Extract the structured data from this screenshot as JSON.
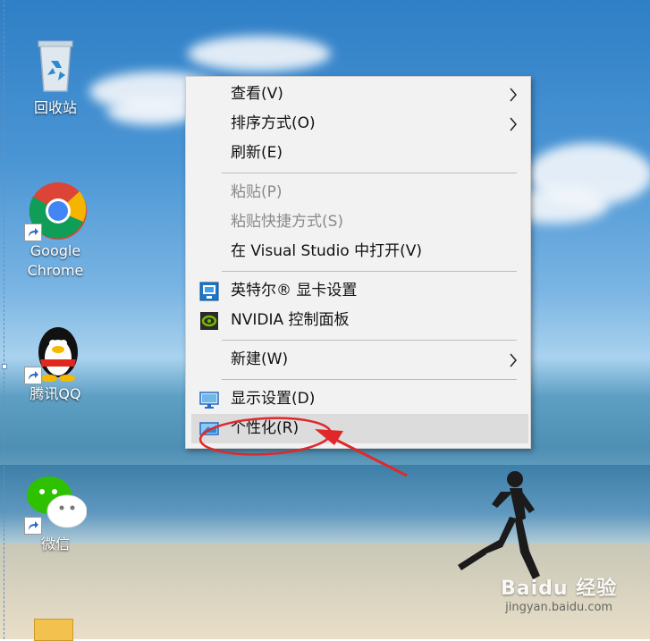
{
  "desktop_icons": [
    {
      "id": "recycle-bin",
      "label": "回收站"
    },
    {
      "id": "chrome",
      "label": "Google Chrome"
    },
    {
      "id": "qq",
      "label": "腾讯QQ"
    },
    {
      "id": "wechat",
      "label": "微信"
    }
  ],
  "context_menu": {
    "view": "查看(V)",
    "sort": "排序方式(O)",
    "refresh": "刷新(E)",
    "paste": "粘贴(P)",
    "paste_shortcut": "粘贴快捷方式(S)",
    "open_vs": "在 Visual Studio 中打开(V)",
    "intel_graphics": "英特尔® 显卡设置",
    "nvidia_panel": "NVIDIA 控制面板",
    "new": "新建(W)",
    "display_settings": "显示设置(D)",
    "personalize": "个性化(R)"
  },
  "watermark": {
    "logo_text": "Baidu 经验",
    "url": "jingyan.baidu.com"
  },
  "colors": {
    "highlight": "#dcdcdc",
    "annotation": "#e0282a",
    "menu_bg": "#f2f2f2"
  }
}
